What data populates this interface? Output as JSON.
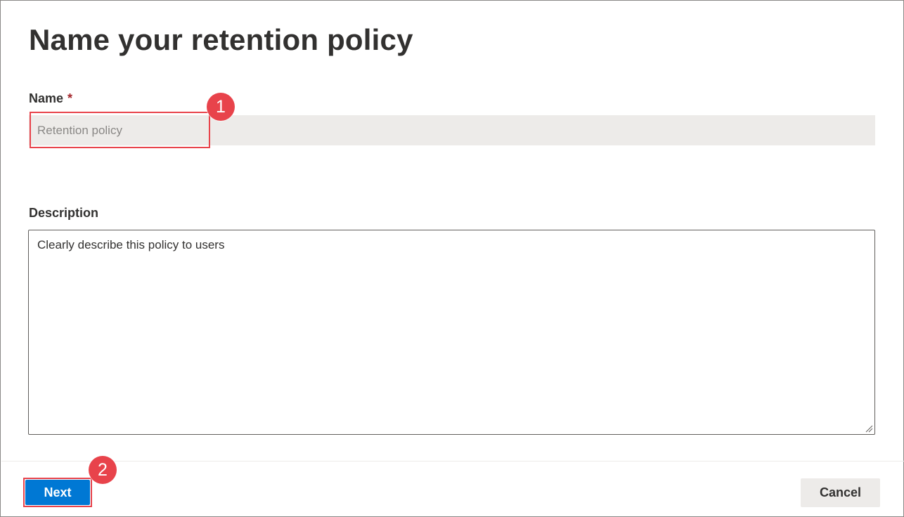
{
  "page": {
    "title": "Name your retention policy"
  },
  "form": {
    "name": {
      "label": "Name",
      "required_marker": "*",
      "placeholder": "Retention policy",
      "value": ""
    },
    "description": {
      "label": "Description",
      "placeholder": "Clearly describe this policy to users",
      "value": ""
    }
  },
  "footer": {
    "next_label": "Next",
    "cancel_label": "Cancel"
  },
  "annotations": {
    "step1": "1",
    "step2": "2",
    "highlight_color": "#e8434b"
  },
  "colors": {
    "primary": "#0078d4",
    "required": "#a4262c",
    "input_bg": "#edebe9"
  }
}
